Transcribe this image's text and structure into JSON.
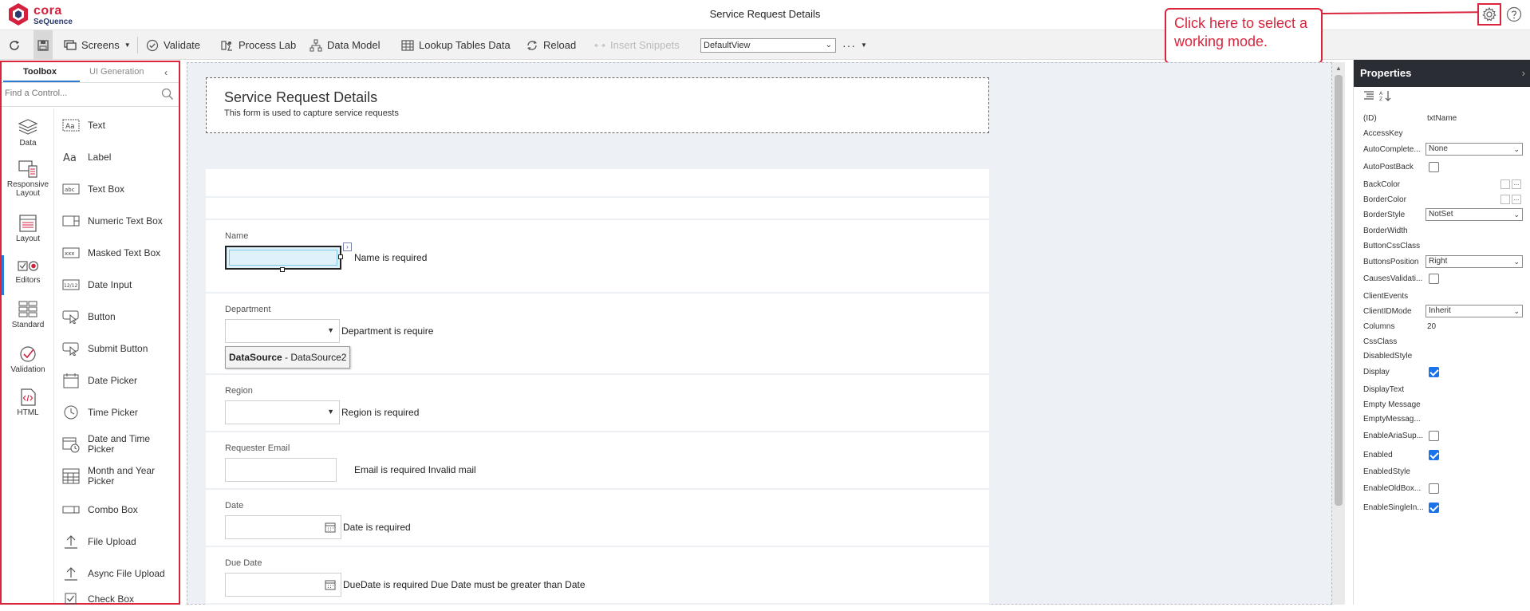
{
  "app": {
    "logo_name": "cora",
    "logo_sub": "SeQuence",
    "title": "Service Request Details"
  },
  "callout": {
    "text": "Click here to select a working mode."
  },
  "toolbar": {
    "screens": "Screens",
    "validate": "Validate",
    "process_lab": "Process Lab",
    "data_model": "Data Model",
    "lookup_tables": "Lookup Tables Data",
    "reload": "Reload",
    "insert_snippets": "Insert Snippets",
    "view_select": "DefaultView"
  },
  "left_panel": {
    "tabs": [
      "Toolbox",
      "UI Generation"
    ],
    "search_placeholder": "Find a Control...",
    "categories": [
      "Data",
      "Responsive Layout",
      "Layout",
      "Editors",
      "Standard",
      "Validation",
      "HTML"
    ],
    "controls": [
      {
        "label": "Text",
        "icon": "text-icon"
      },
      {
        "label": "Label",
        "icon": "label-icon"
      },
      {
        "label": "Text Box",
        "icon": "textbox-icon"
      },
      {
        "label": "Numeric Text Box",
        "icon": "numeric-textbox-icon"
      },
      {
        "label": "Masked Text Box",
        "icon": "masked-textbox-icon"
      },
      {
        "label": "Date Input",
        "icon": "date-input-icon"
      },
      {
        "label": "Button",
        "icon": "button-cursor-icon"
      },
      {
        "label": "Submit Button",
        "icon": "submit-button-icon"
      },
      {
        "label": "Date Picker",
        "icon": "calendar-icon"
      },
      {
        "label": "Time Picker",
        "icon": "clock-icon"
      },
      {
        "label": "Date and Time Picker",
        "icon": "datetime-icon"
      },
      {
        "label": "Month and Year Picker",
        "icon": "month-year-icon"
      },
      {
        "label": "Combo Box",
        "icon": "combobox-icon"
      },
      {
        "label": "File Upload",
        "icon": "upload-icon"
      },
      {
        "label": "Async File Upload",
        "icon": "async-upload-icon"
      },
      {
        "label": "Check Box",
        "icon": "checkbox-icon"
      }
    ]
  },
  "form": {
    "header_title": "Service Request Details",
    "header_subtitle": "This form is used to capture service requests",
    "fields": {
      "name": {
        "label": "Name",
        "message": "Name is required"
      },
      "department": {
        "label": "Department",
        "message": "Department is require",
        "datasource_label": "DataSource",
        "datasource_value": " - DataSource2"
      },
      "region": {
        "label": "Region",
        "message": "Region is required"
      },
      "email": {
        "label": "Requester Email",
        "message": "Email is required Invalid mail"
      },
      "date": {
        "label": "Date",
        "message": "Date is required"
      },
      "due_date": {
        "label": "Due Date",
        "message": "DueDate is required Due Date must be greater than Date"
      }
    }
  },
  "properties": {
    "title": "Properties",
    "rows": [
      {
        "name": "(ID)",
        "type": "text",
        "value": "txtName"
      },
      {
        "name": "AccessKey",
        "type": "text",
        "value": ""
      },
      {
        "name": "AutoComplete...",
        "type": "select",
        "value": "None"
      },
      {
        "name": "AutoPostBack",
        "type": "check",
        "value": false
      },
      {
        "name": "BackColor",
        "type": "color",
        "value": ""
      },
      {
        "name": "BorderColor",
        "type": "color",
        "value": ""
      },
      {
        "name": "BorderStyle",
        "type": "select",
        "value": "NotSet"
      },
      {
        "name": "BorderWidth",
        "type": "text",
        "value": ""
      },
      {
        "name": "ButtonCssClass",
        "type": "text",
        "value": ""
      },
      {
        "name": "ButtonsPosition",
        "type": "select",
        "value": "Right"
      },
      {
        "name": "CausesValidati...",
        "type": "check",
        "value": false
      },
      {
        "name": "ClientEvents",
        "type": "text",
        "value": ""
      },
      {
        "name": "ClientIDMode",
        "type": "select",
        "value": "Inherit"
      },
      {
        "name": "Columns",
        "type": "text",
        "value": "20"
      },
      {
        "name": "CssClass",
        "type": "text",
        "value": ""
      },
      {
        "name": "DisabledStyle",
        "type": "text",
        "value": ""
      },
      {
        "name": "Display",
        "type": "check",
        "value": true
      },
      {
        "name": "DisplayText",
        "type": "text",
        "value": ""
      },
      {
        "name": "Empty Message",
        "type": "text",
        "value": ""
      },
      {
        "name": "EmptyMessag...",
        "type": "text",
        "value": ""
      },
      {
        "name": "EnableAriaSup...",
        "type": "check",
        "value": false
      },
      {
        "name": "Enabled",
        "type": "check",
        "value": true
      },
      {
        "name": "EnabledStyle",
        "type": "text",
        "value": ""
      },
      {
        "name": "EnableOldBox...",
        "type": "check",
        "value": false
      },
      {
        "name": "EnableSingleIn...",
        "type": "check",
        "value": true
      }
    ]
  },
  "colors": {
    "accent_red": "#d9263e",
    "canvas_bg": "#edf0f5",
    "props_header": "#2a2d33",
    "check_blue": "#1a73e8"
  }
}
